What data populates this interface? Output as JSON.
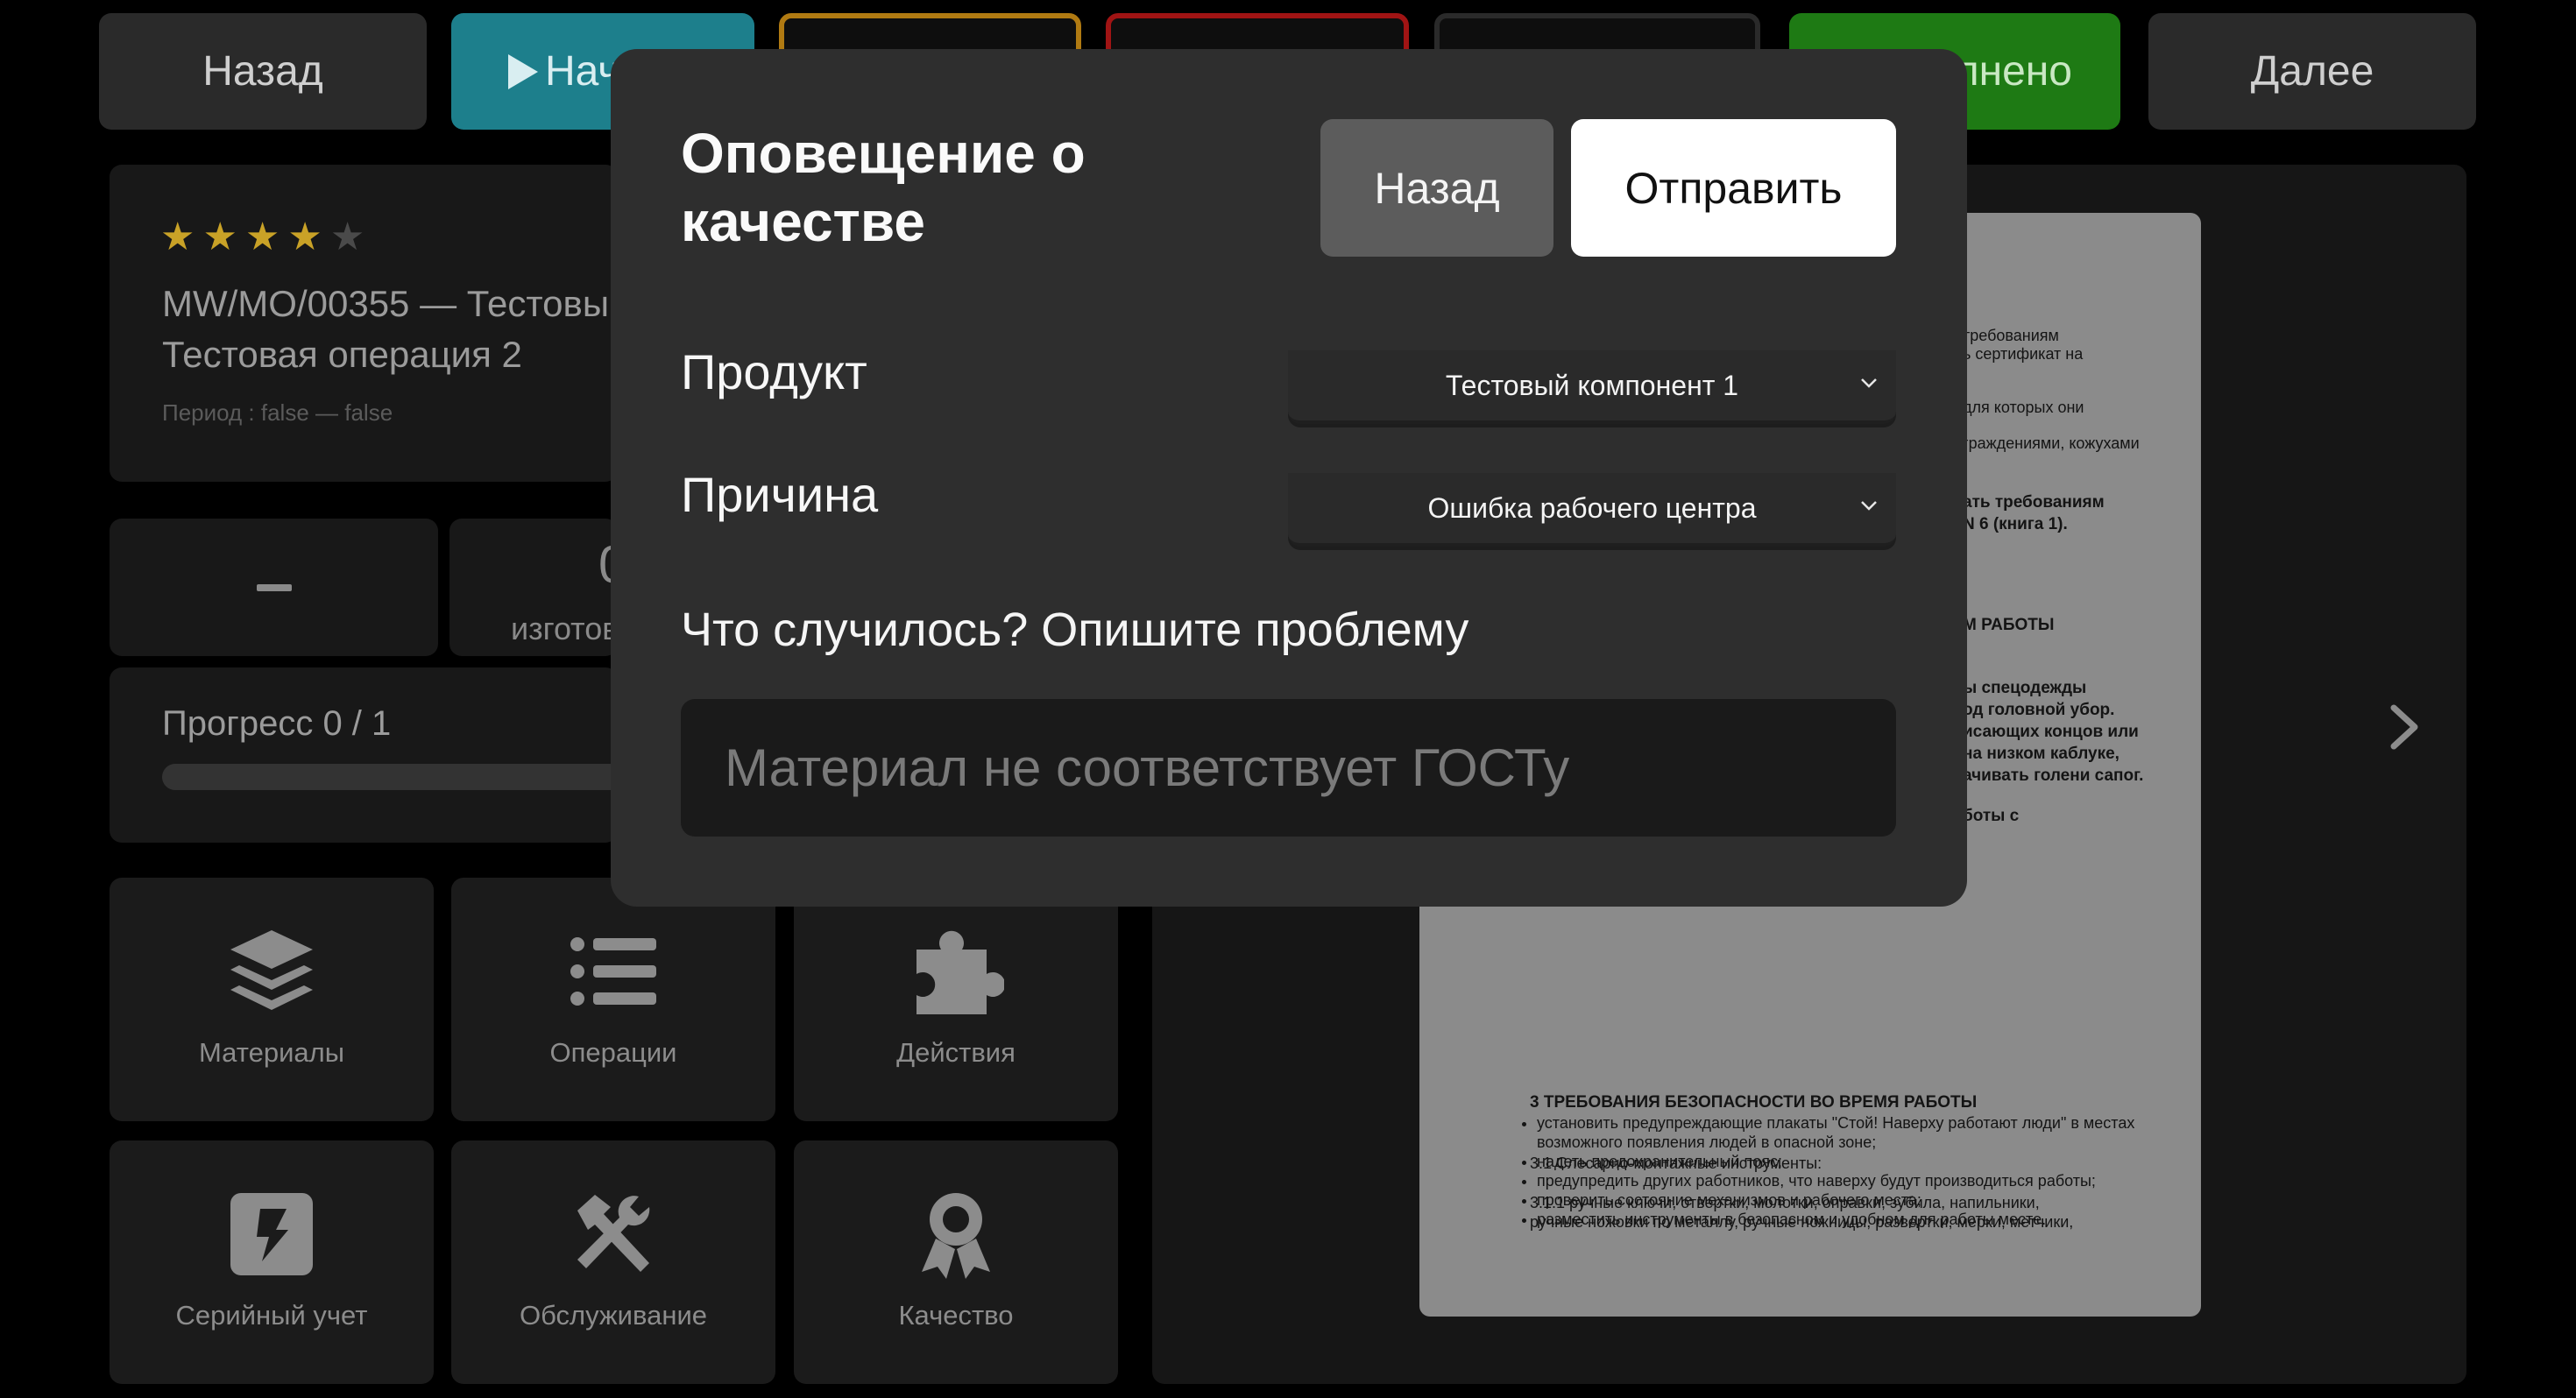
{
  "topbar": {
    "back_label": "Назад",
    "start_label": "Нач",
    "done_label": "лнено",
    "next_label": "Далее",
    "outline_colors": [
      "#b07a12",
      "#a01414",
      "#2a2a2a"
    ]
  },
  "workorder": {
    "rating": 4,
    "rating_max": 5,
    "title_line1": "MW/MO/00355 — Тестовы",
    "title_line2": "Тестовая операция 2",
    "period": "Период : false — false",
    "made_label": "изготов",
    "made_value": "0",
    "progress_label": "Прогресс 0 / 1",
    "progress_fraction": 0
  },
  "tiles": [
    {
      "label": "Материалы",
      "icon": "layers-icon"
    },
    {
      "label": "Операции",
      "icon": "list-icon"
    },
    {
      "label": "Действия",
      "icon": "puzzle-icon"
    },
    {
      "label": "Серийный учет",
      "icon": "bolt-icon"
    },
    {
      "label": "Обслуживание",
      "icon": "tools-icon"
    },
    {
      "label": "Качество",
      "icon": "award-icon"
    }
  ],
  "document": {
    "right_fragments": [
      "требованиям",
      "ь сертификат на",
      "для которых они",
      "граждениями, кожухами",
      "ать требованиям",
      "N 6 (книга 1).",
      "М РАБОТЫ",
      "ы спецодежды",
      "од головной убор.",
      "исающих концов или",
      "на низком каблуке,",
      "ачивать голени сапог.",
      "боты с"
    ],
    "list_items": [
      "установить предупреждающие плакаты \"Стой! Наверху работают люди\" в местах возможного появления людей в опасной зоне;",
      "надеть предохранительный пояс;",
      "предупредить других работников, что наверху будут производиться работы;",
      "проверить состояние механизмов и рабочего места;",
      "разместить инструменты в безопасном и удобном для работы месте."
    ],
    "section_heading": "3 ТРЕБОВАНИЯ БЕЗОПАСНОСТИ ВО ВРЕМЯ РАБОТЫ",
    "subsection": "3.1 Слесарно-монтажные инструменты:",
    "para_line1": "3.1.1 ручные ключи, отвертки, молотки, оправки, зубила, напильники,",
    "para_line2": "ручные ножовки по металлу, ручные ножницы, развертки, мерки, метчики,"
  },
  "modal": {
    "title_line1": "Оповещение о",
    "title_line2": "качестве",
    "back_label": "Назад",
    "send_label": "Отправить",
    "product_label": "Продукт",
    "product_value": "Тестовый компонент 1",
    "reason_label": "Причина",
    "reason_value": "Ошибка рабочего центра",
    "question": "Что случилось? Опишите проблему",
    "description_placeholder": "Материал не соответствует ГОСТу"
  }
}
